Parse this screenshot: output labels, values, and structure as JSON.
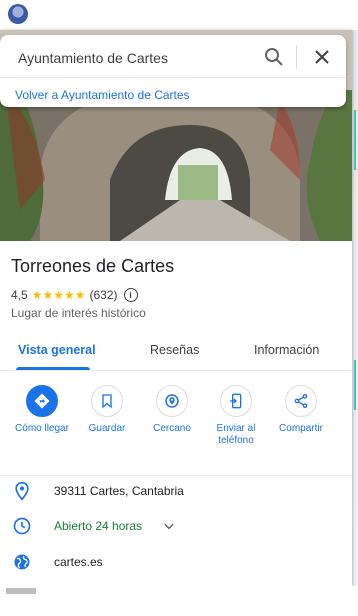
{
  "search": {
    "value": "Ayuntamiento de Cartes",
    "back_link": "Volver a Ayuntamiento de Cartes"
  },
  "place": {
    "name": "Torreones de Cartes",
    "rating": "4,5",
    "stars": "★★★★★",
    "reviews_count": "(632)",
    "rating_value": 4.5,
    "category": "Lugar de interés histórico"
  },
  "tabs": [
    {
      "label": "Vista general",
      "active": true
    },
    {
      "label": "Reseñas",
      "active": false
    },
    {
      "label": "Información",
      "active": false
    }
  ],
  "actions": [
    {
      "label": "Cómo llegar",
      "icon": "directions-icon"
    },
    {
      "label": "Guardar",
      "icon": "bookmark-icon"
    },
    {
      "label": "Cercano",
      "icon": "nearby-icon"
    },
    {
      "label": "Enviar al teléfono",
      "icon": "send-to-phone-icon"
    },
    {
      "label": "Compartir",
      "icon": "share-icon"
    }
  ],
  "details": {
    "address": "39311 Cartes, Cantabria",
    "hours": "Abierto 24 horas",
    "website": "cartes.es"
  },
  "colors": {
    "accent": "#1a73e8",
    "open_green": "#188038",
    "star": "#fbbc04"
  }
}
